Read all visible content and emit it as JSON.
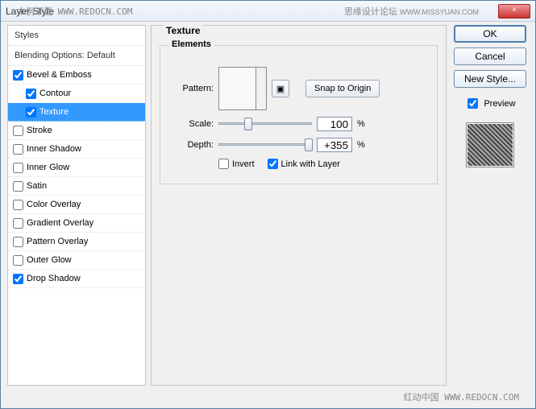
{
  "window": {
    "title": "Layer Style",
    "close": "×"
  },
  "overlays": {
    "left": "本例下载 WWW.REDOCN.COM",
    "right1": "思缘设计论坛 ",
    "right2": "WWW.MISSYUAN.COM",
    "footer": "红动中国 WWW.REDOCN.COM"
  },
  "styles": {
    "header": "Styles",
    "blending": "Blending Options: Default",
    "items": [
      {
        "label": "Bevel & Emboss",
        "checked": true,
        "selected": false,
        "sub": false
      },
      {
        "label": "Contour",
        "checked": true,
        "selected": false,
        "sub": true
      },
      {
        "label": "Texture",
        "checked": true,
        "selected": true,
        "sub": true
      },
      {
        "label": "Stroke",
        "checked": false,
        "selected": false,
        "sub": false
      },
      {
        "label": "Inner Shadow",
        "checked": false,
        "selected": false,
        "sub": false
      },
      {
        "label": "Inner Glow",
        "checked": false,
        "selected": false,
        "sub": false
      },
      {
        "label": "Satin",
        "checked": false,
        "selected": false,
        "sub": false
      },
      {
        "label": "Color Overlay",
        "checked": false,
        "selected": false,
        "sub": false
      },
      {
        "label": "Gradient Overlay",
        "checked": false,
        "selected": false,
        "sub": false
      },
      {
        "label": "Pattern Overlay",
        "checked": false,
        "selected": false,
        "sub": false
      },
      {
        "label": "Outer Glow",
        "checked": false,
        "selected": false,
        "sub": false
      },
      {
        "label": "Drop Shadow",
        "checked": true,
        "selected": false,
        "sub": false
      }
    ]
  },
  "texture": {
    "title": "Texture",
    "group": "Elements",
    "pattern_label": "Pattern:",
    "snap": "Snap to Origin",
    "scale_label": "Scale:",
    "scale_value": "100",
    "depth_label": "Depth:",
    "depth_value": "+355",
    "percent": "%",
    "invert": "Invert",
    "link": "Link with Layer",
    "invert_checked": false,
    "link_checked": true,
    "scale_thumb_pct": 28,
    "depth_thumb_pct": 92
  },
  "side": {
    "ok": "OK",
    "cancel": "Cancel",
    "newstyle": "New Style...",
    "preview": "Preview",
    "preview_checked": true
  }
}
